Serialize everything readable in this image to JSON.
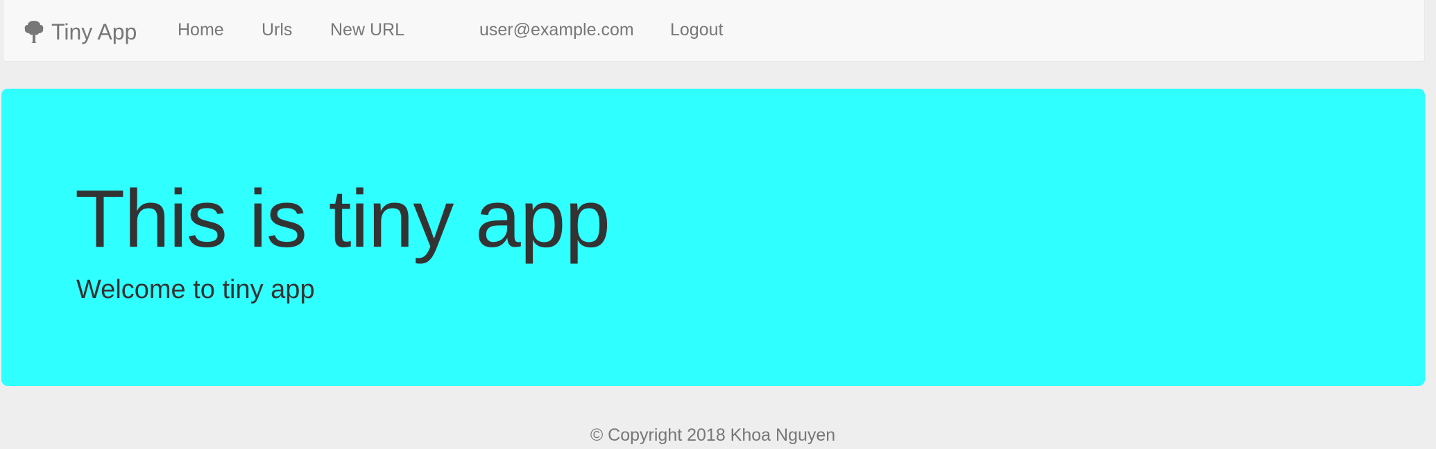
{
  "navbar": {
    "brand": {
      "icon": "tree-icon",
      "label": "Tiny App"
    },
    "links": {
      "home": "Home",
      "urls": "Urls",
      "new_url": "New URL"
    },
    "user_email": "user@example.com",
    "logout": "Logout"
  },
  "jumbotron": {
    "title": "This is tiny app",
    "subtitle": "Welcome to tiny app",
    "background_color": "#2fffff"
  },
  "footer": {
    "copyright": "© Copyright 2018 Khoa Nguyen"
  }
}
